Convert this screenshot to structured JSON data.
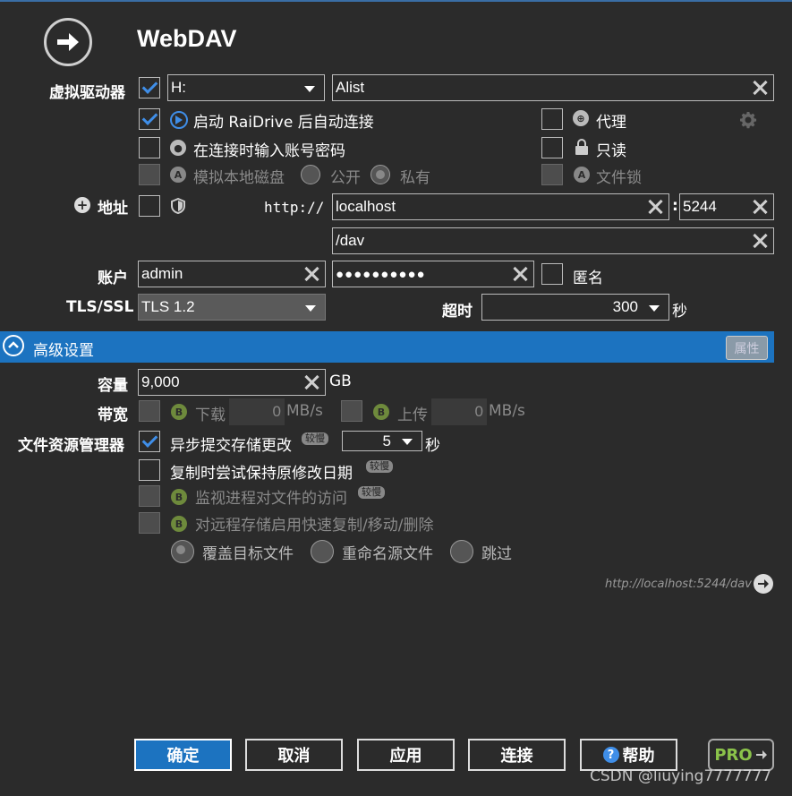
{
  "title": "WebDAV",
  "labels": {
    "virtual_drive": "虚拟驱动器",
    "address": "地址",
    "account": "账户",
    "tls": "TLS/SSL",
    "timeout": "超时",
    "seconds": "秒",
    "capacity": "容量",
    "bandwidth": "带宽",
    "file_manager": "文件资源管理器"
  },
  "drive": {
    "letter": "H:",
    "name": "Alist"
  },
  "options": {
    "auto_connect": "启动 RaiDrive 后自动连接",
    "prompt_credentials": "在连接时输入账号密码",
    "emulate_local": "模拟本地磁盘",
    "public": "公开",
    "private": "私有",
    "proxy": "代理",
    "readonly": "只读",
    "file_lock": "文件锁"
  },
  "address": {
    "scheme": "http://",
    "host": "localhost",
    "port": "5244",
    "path": "/dav"
  },
  "account": {
    "user": "admin",
    "password": "●●●●●●●●●●",
    "anonymous": "匿名"
  },
  "tls": {
    "value": "TLS 1.2",
    "timeout": "300"
  },
  "advanced": {
    "title": "高级设置",
    "props": "属性"
  },
  "capacity": {
    "value": "9,000",
    "unit": "GB"
  },
  "bandwidth": {
    "down": "下载",
    "down_val": "0",
    "up": "上传",
    "up_val": "0",
    "unit": "MB/s"
  },
  "fm": {
    "async": "异步提交存储更改",
    "async_badge": "较慢",
    "async_val": "5",
    "async_unit": "秒",
    "keep_date": "复制时尝试保持原修改日期",
    "keep_badge": "较慢",
    "monitor": "监视进程对文件的访问",
    "monitor_badge": "较慢",
    "fast_copy": "对远程存储启用快速复制/移动/删除",
    "overwrite": "覆盖目标文件",
    "rename": "重命名源文件",
    "skip": "跳过"
  },
  "url_preview": "http://localhost:5244/dav",
  "buttons": {
    "ok": "确定",
    "cancel": "取消",
    "apply": "应用",
    "connect": "连接",
    "help": "帮助",
    "pro": "PRO"
  },
  "watermark": "CSDN @liuying7777777"
}
